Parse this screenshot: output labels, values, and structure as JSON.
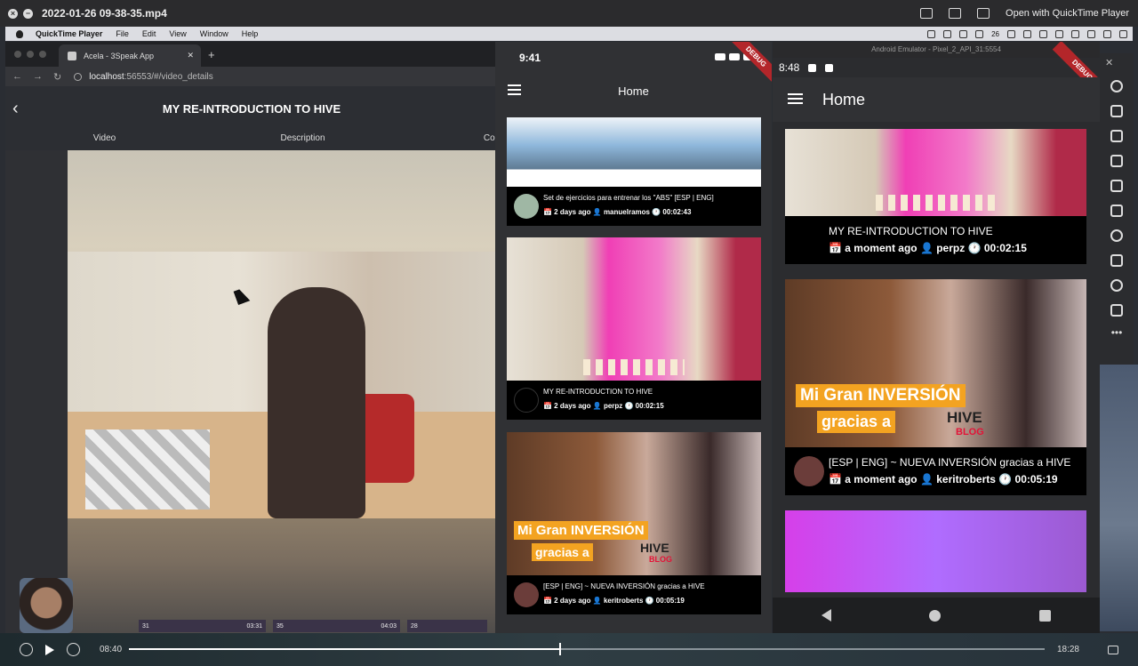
{
  "quicktime": {
    "filename": "2022-01-26 09-38-35.mp4",
    "open_with": "Open with QuickTime Player",
    "current_time": "08:40",
    "duration": "18:28",
    "progress": 0.47
  },
  "menubar": {
    "app": "QuickTime Player",
    "items": [
      "File",
      "Edit",
      "View",
      "Window",
      "Help"
    ],
    "status_num": "26"
  },
  "browser": {
    "tab_title": "Acela - 3Speak App",
    "url_host": "localhost",
    "url_rest": ":56553/#/video_details",
    "page_title": "MY RE-INTRODUCTION TO HIVE",
    "tabs": [
      "Video",
      "Description",
      "Cor"
    ],
    "thumbs": [
      {
        "left": "31",
        "right": "03:31"
      },
      {
        "left": "35",
        "right": "04:03"
      },
      {
        "left": "28",
        "right": ""
      }
    ]
  },
  "ios": {
    "time": "9:41",
    "title": "Home",
    "debug": "DEBUG",
    "cards": [
      {
        "title": "Set de ejercicios para entrenar los \"ABS\"  [ESP | ENG]",
        "meta": "📅 2 days ago 👤 manuelramos 🕐 00:02:43"
      },
      {
        "title": "MY RE-INTRODUCTION TO HIVE",
        "meta": "📅 2 days ago 👤 perpz 🕐 00:02:15"
      },
      {
        "title": "[ESP | ENG] ~ NUEVA INVERSIÓN gracias a HIVE",
        "meta": "📅 2 days ago 👤 keritroberts 🕐 00:05:19"
      }
    ],
    "banner_line1": "Mi Gran INVERSIÓN",
    "banner_line2": "gracias a",
    "hive_word": "HIVE",
    "blog_word": "BLOG"
  },
  "android": {
    "emulator_title": "Android Emulator - Pixel_2_API_31:5554",
    "time": "8:48",
    "title": "Home",
    "debug": "DEBUG",
    "cards": [
      {
        "title": "MY RE-INTRODUCTION TO HIVE",
        "meta": "📅 a moment ago 👤 perpz 🕐 00:02:15"
      },
      {
        "title": "[ESP | ENG] ~ NUEVA INVERSIÓN gracias a HIVE",
        "meta": "📅 a moment ago 👤 keritroberts 🕐 00:05:19"
      }
    ],
    "banner_line1": "Mi Gran INVERSIÓN",
    "banner_line2": "gracias a",
    "hive_word": "HIVE",
    "blog_word": "BLOG"
  },
  "colors": {
    "accent": "#33c49b",
    "debug_ribbon": "#b3262a",
    "hive_orange": "#f3a321"
  }
}
